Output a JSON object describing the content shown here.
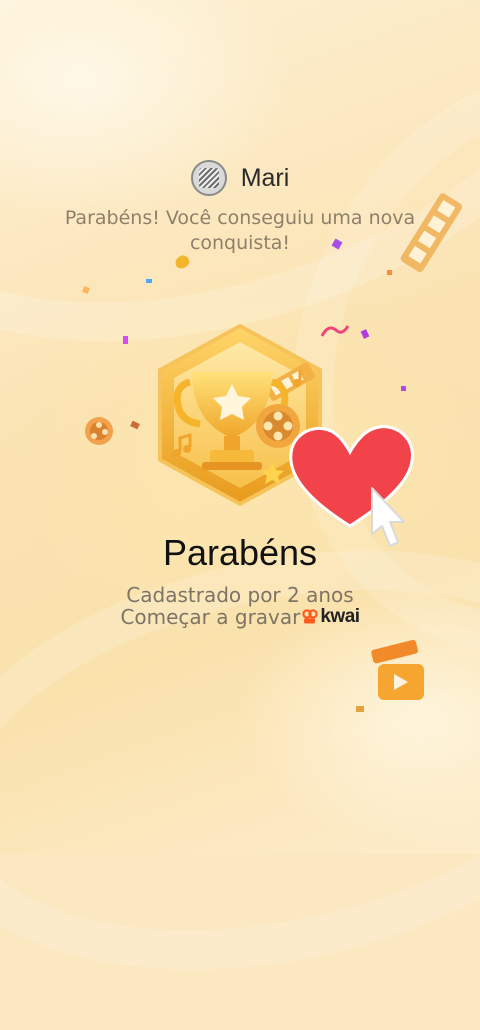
{
  "header": {
    "username": "Mari"
  },
  "subtitle": "Parabéns! Você conseguiu uma nova conquista!",
  "achievement": {
    "title": "Parabéns",
    "description": "Cadastrado por 2 anos",
    "cta": "Começar a gravar",
    "brand": "kwai"
  },
  "icons": {
    "avatar": "avatar-icon",
    "badge": "trophy-badge-icon",
    "like": "heart-icon",
    "cursor": "tap-hand-icon",
    "brand": "kwai-logo-icon"
  },
  "colors": {
    "heart": "#f2424a",
    "badge_gold": "#f5b42a",
    "kwai_orange": "#ff5a1f"
  }
}
